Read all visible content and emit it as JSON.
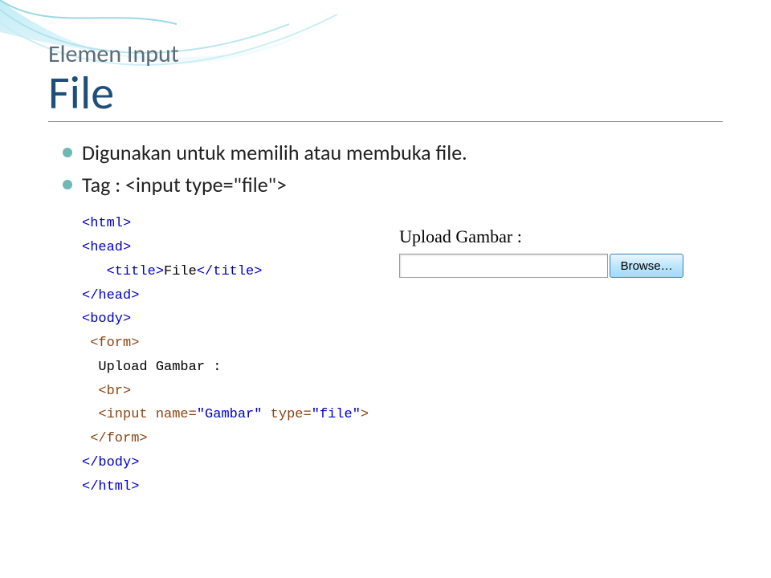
{
  "heading": {
    "pretitle": "Elemen Input",
    "title": "File"
  },
  "bullets": [
    "Digunakan untuk memilih atau membuka file.",
    "Tag : <input type=\"file\">"
  ],
  "code": {
    "html_open": "<html>",
    "head_open": "<head>",
    "title_open": "<title>",
    "title_text": "File",
    "title_close": "</title>",
    "head_close": "</head>",
    "body_open": "<body>",
    "form_open": "<form>",
    "upload_text": "Upload Gambar :",
    "br": "<br>",
    "input_open": "<input",
    "attr_name_key": " name=",
    "attr_name_val": "\"Gambar\"",
    "attr_type_key": " type=",
    "attr_type_val": "\"file\"",
    "input_close": ">",
    "form_close": "</form>",
    "body_close": "</body>",
    "html_close": "</html>"
  },
  "preview": {
    "label": "Upload Gambar :",
    "input_value": "",
    "browse_label": "Browse…"
  }
}
